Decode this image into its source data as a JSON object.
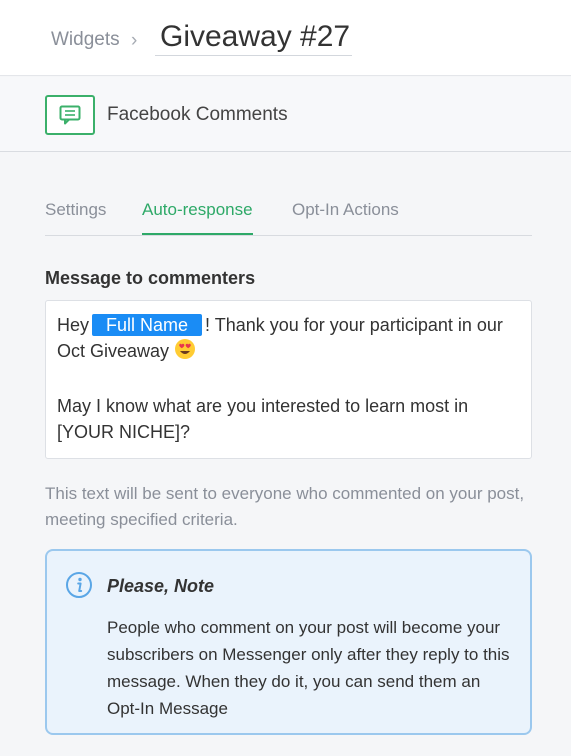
{
  "breadcrumb": {
    "parent": "Widgets",
    "separator": "›"
  },
  "title": "Giveaway #27",
  "widget": {
    "label": "Facebook Comments",
    "icon": "comment-icon"
  },
  "tabs": [
    {
      "label": "Settings",
      "active": false
    },
    {
      "label": "Auto-response",
      "active": true
    },
    {
      "label": "Opt-In Actions",
      "active": false
    }
  ],
  "message": {
    "label": "Message to commenters",
    "greeting": "Hey",
    "variable": "Full Name",
    "line1_rest": "! Thank you for your participant in our",
    "line2": "Oct Giveaway",
    "emoji": "heart-eyes-emoji",
    "line3": "May I know what are you interested to learn most in",
    "line4": "[YOUR NICHE]?"
  },
  "hint": "This text will be sent to everyone who commented on your post, meeting specified criteria.",
  "note": {
    "icon": "info-icon",
    "title": "Please, Note",
    "body": "People who comment on your post will become your subscribers on Messenger only after they reply to this message. When they do it, you can send them an Opt-In Message"
  },
  "colors": {
    "accent": "#2ea968",
    "chip": "#1a8cf5",
    "note_border": "#9bc8ee",
    "note_bg": "#eaf3fc"
  }
}
